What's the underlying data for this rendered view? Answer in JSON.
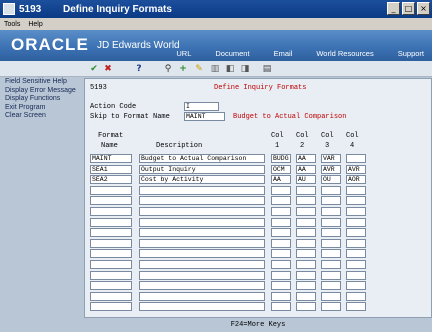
{
  "window": {
    "number": "5193",
    "title": "Define Inquiry Formats",
    "controls": [
      "_",
      "□",
      "×"
    ]
  },
  "menu": {
    "tools": "Tools",
    "help": "Help"
  },
  "brand": {
    "oracle": "ORACLE",
    "product": "JD Edwards World",
    "links": [
      "URL",
      "Document",
      "Email",
      "World Resources",
      "Support"
    ]
  },
  "sidebar": {
    "items": [
      "Field Sensitive Help",
      "Display Error Message",
      "Display Functions",
      "Exit Program",
      "Clear Screen"
    ]
  },
  "form": {
    "program_id": "5193",
    "header_title": "Define Inquiry Formats",
    "action_code_label": "Action Code",
    "action_code_value": "I",
    "skip_to_label": "Skip to Format Name",
    "skip_to_value": "MAINT",
    "skip_to_description": "Budget to Actual Comparison",
    "columns": {
      "format": "Format",
      "name": "Name",
      "description": "Description",
      "col": "Col",
      "col1": "1",
      "col2": "2",
      "col3": "3",
      "col4": "4"
    },
    "rows": [
      {
        "name": "MAINT",
        "description": "Budget to Actual Comparison",
        "c1": "BUDG",
        "c2": "AA",
        "c3": "VAR",
        "c4": ""
      },
      {
        "name": "SEA1",
        "description": "Output Inquiry",
        "c1": "OCM",
        "c2": "AA",
        "c3": "AVR",
        "c4": "AVR"
      },
      {
        "name": "SEA2",
        "description": "Cost by Activity",
        "c1": "AA",
        "c2": "AU",
        "c3": "OU",
        "c4": "AOR"
      },
      {
        "name": "",
        "description": "",
        "c1": "",
        "c2": "",
        "c3": "",
        "c4": ""
      },
      {
        "name": "",
        "description": "",
        "c1": "",
        "c2": "",
        "c3": "",
        "c4": ""
      },
      {
        "name": "",
        "description": "",
        "c1": "",
        "c2": "",
        "c3": "",
        "c4": ""
      },
      {
        "name": "",
        "description": "",
        "c1": "",
        "c2": "",
        "c3": "",
        "c4": ""
      },
      {
        "name": "",
        "description": "",
        "c1": "",
        "c2": "",
        "c3": "",
        "c4": ""
      },
      {
        "name": "",
        "description": "",
        "c1": "",
        "c2": "",
        "c3": "",
        "c4": ""
      },
      {
        "name": "",
        "description": "",
        "c1": "",
        "c2": "",
        "c3": "",
        "c4": ""
      },
      {
        "name": "",
        "description": "",
        "c1": "",
        "c2": "",
        "c3": "",
        "c4": ""
      },
      {
        "name": "",
        "description": "",
        "c1": "",
        "c2": "",
        "c3": "",
        "c4": ""
      },
      {
        "name": "",
        "description": "",
        "c1": "",
        "c2": "",
        "c3": "",
        "c4": ""
      },
      {
        "name": "",
        "description": "",
        "c1": "",
        "c2": "",
        "c3": "",
        "c4": ""
      },
      {
        "name": "",
        "description": "",
        "c1": "",
        "c2": "",
        "c3": "",
        "c4": ""
      }
    ],
    "footer": "F24=More Keys"
  },
  "toolbar_icons": [
    "check-icon",
    "cancel-icon",
    "help-icon",
    "search-icon",
    "add-icon",
    "edit-icon",
    "delete-icon",
    "previous-icon",
    "next-icon",
    "print-icon"
  ]
}
